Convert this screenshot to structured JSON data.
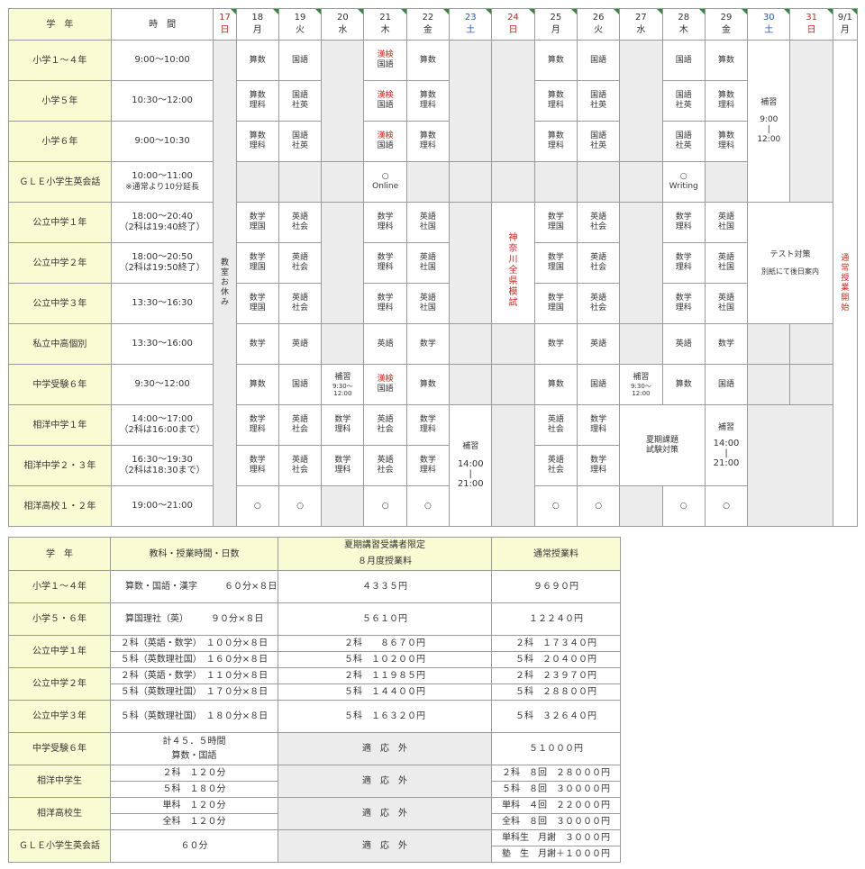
{
  "schedule": {
    "header": {
      "grade_label": "学　年",
      "time_label": "時　間",
      "days": [
        {
          "num": "17",
          "dow": "日",
          "color": "red"
        },
        {
          "num": "18",
          "dow": "月",
          "color": ""
        },
        {
          "num": "19",
          "dow": "火",
          "color": ""
        },
        {
          "num": "20",
          "dow": "水",
          "color": ""
        },
        {
          "num": "21",
          "dow": "木",
          "color": ""
        },
        {
          "num": "22",
          "dow": "金",
          "color": ""
        },
        {
          "num": "23",
          "dow": "土",
          "color": "blue"
        },
        {
          "num": "24",
          "dow": "日",
          "color": "red"
        },
        {
          "num": "25",
          "dow": "月",
          "color": ""
        },
        {
          "num": "26",
          "dow": "火",
          "color": ""
        },
        {
          "num": "27",
          "dow": "水",
          "color": ""
        },
        {
          "num": "28",
          "dow": "木",
          "color": ""
        },
        {
          "num": "29",
          "dow": "金",
          "color": ""
        },
        {
          "num": "30",
          "dow": "土",
          "color": "blue"
        },
        {
          "num": "31",
          "dow": "日",
          "color": "red"
        },
        {
          "num": "9/1",
          "dow": "月",
          "color": ""
        }
      ]
    },
    "rows": [
      {
        "grade": "小学１～４年",
        "time": "9:00～10:00",
        "time2": ""
      },
      {
        "grade": "小学５年",
        "time": "10:30～12:00",
        "time2": ""
      },
      {
        "grade": "小学６年",
        "time": "9:00～10:30",
        "time2": ""
      },
      {
        "grade": "ＧＬＥ小学生英会話",
        "time": "10:00～11:00",
        "time2": "※通常より10分延長"
      },
      {
        "grade": "公立中学１年",
        "time": "18:00～20:40",
        "time2": "（2科は19:40終了）"
      },
      {
        "grade": "公立中学２年",
        "time": "18:00～20:50",
        "time2": "（2科は19:50終了）"
      },
      {
        "grade": "公立中学３年",
        "time": "13:30～16:30",
        "time2": ""
      },
      {
        "grade": "私立中高個別",
        "time": "13:30～16:00",
        "time2": ""
      },
      {
        "grade": "中学受験６年",
        "time": "9:30～12:00",
        "time2": ""
      },
      {
        "grade": "相洋中学１年",
        "time": "14:00～17:00",
        "time2": "（2科は16:00まで）"
      },
      {
        "grade": "相洋中学２・３年",
        "time": "16:30～19:30",
        "time2": "（2科は18:30まで）"
      },
      {
        "grade": "相洋高校１・２年",
        "time": "19:00～21:00",
        "time2": ""
      }
    ],
    "cells": {
      "sansu": "算数",
      "kokugo": "国語",
      "kanken": "漢検",
      "sansu_rika": "算数\n理科",
      "kokugo_shaei": "国語\n社英",
      "online_mark": "○",
      "online": "Online",
      "writing_mark": "○",
      "writing": "Writing",
      "sugaku_rikoku": "数学\n理国",
      "eigo_shakai": "英語\n社会",
      "sugaku_rika": "数学\n理科",
      "eigo_shakoku": "英語\n社国",
      "sugaku": "数学",
      "eigo": "英語",
      "eigo_shakai2": "英語\n社会",
      "circle": "○",
      "hoshu_small": "補習",
      "hoshu_small_time": "9:30～\n12:00",
      "holiday": "教室お休み",
      "mock": "神奈川全県模試",
      "regular_start": "通常授業開始",
      "hoshu_30": "補習",
      "hoshu_30_time": "9:00\n|\n12:00",
      "test_prep": "テスト対策",
      "test_prep_sub": "別紙にて後日案内",
      "hoshu_23": "補習",
      "hoshu_23_time": "14:00\n|\n21:00",
      "summer_task": "夏期課題\n試験対策",
      "hoshu_29": "補習",
      "hoshu_29_time": "14:00\n|\n21:00"
    }
  },
  "fees": {
    "header": {
      "grade": "学　年",
      "subjects": "教科・授業時間・日数",
      "summer": "夏期講習受講者限定\n８月度授業料",
      "regular": "通常授業料"
    },
    "rows": {
      "r1": {
        "grade": "小学１～４年",
        "subj": "算数・国語・漢字　　　６０分×８日",
        "summer": "４３３５円",
        "regular": "９６９０円"
      },
      "r2": {
        "grade": "小学５・６年",
        "subj": "算国理社（英）　　　９０分×８日",
        "summer": "５６１０円",
        "regular": "１２２４０円"
      },
      "r3": {
        "grade": "公立中学１年",
        "subj_a": "２科（英語・数学）　１００分×８日",
        "summer_a": "２科　　８６７０円",
        "regular_a": "２科　１７３４０円",
        "subj_b": "５科（英数理社国）　１６０分×８日",
        "summer_b": "５科　１０２００円",
        "regular_b": "５科　２０４００円"
      },
      "r4": {
        "grade": "公立中学２年",
        "subj_a": "２科（英語・数学）　１１０分×８日",
        "summer_a": "２科　１１９８５円",
        "regular_a": "２科　２３９７０円",
        "subj_b": "５科（英数理社国）　１７０分×８日",
        "summer_b": "５科　１４４００円",
        "regular_b": "５科　２８８００円"
      },
      "r5": {
        "grade": "公立中学３年",
        "subj": "５科（英数理社国）　１８０分×８日",
        "summer": "５科　１６３２０円",
        "regular": "５科　３２６４０円"
      },
      "r6": {
        "grade": "中学受験６年",
        "subj_a": "計４５．５時間",
        "subj_b": "算数・国語",
        "summer": "適　応　外",
        "regular": "５１０００円"
      },
      "r7": {
        "grade": "相洋中学生",
        "subj_a": "２科　１２０分",
        "subj_b": "５科　１８０分",
        "summer": "適　応　外",
        "regular_a": "２科　８回　２８０００円",
        "regular_b": "５科　８回　３００００円"
      },
      "r8": {
        "grade": "相洋高校生",
        "subj_a": "単科　１２０分",
        "subj_b": "全科　１２０分",
        "summer": "適　応　外",
        "regular_a": "単科　４回　２２０００円",
        "regular_b": "全科　８回　３００００円"
      },
      "r9": {
        "grade": "ＧＬＥ小学生英会話",
        "subj": "６０分",
        "summer": "適　応　外",
        "regular_a": "単科生　月謝　３０００円",
        "regular_b": "塾　生　月謝＋１０００円"
      }
    }
  }
}
